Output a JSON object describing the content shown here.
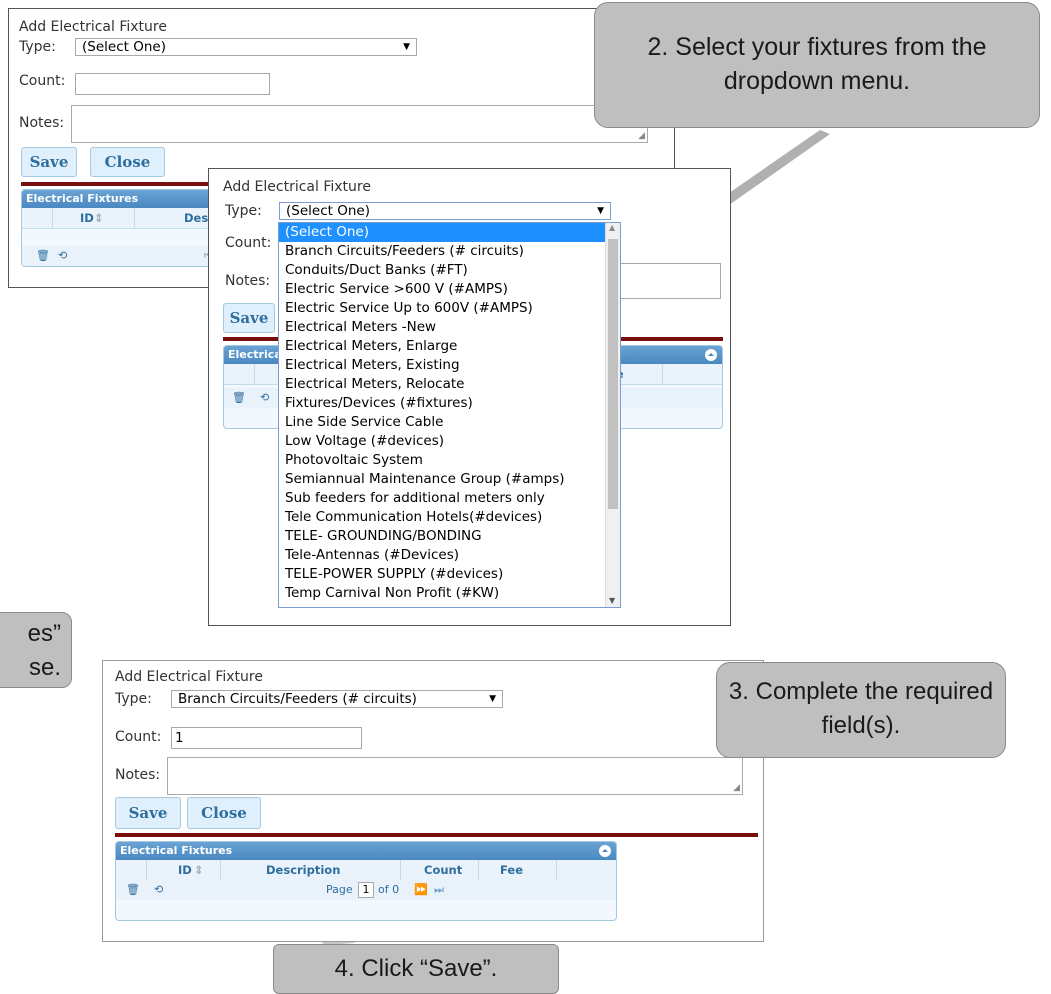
{
  "callouts": {
    "step2": "2. Select your fixtures from the dropdown menu.",
    "step3": "3. Complete the required field(s).",
    "step4": "4. Click “Save”.",
    "partial_left_line1": "es”",
    "partial_left_line2": "se."
  },
  "panel1": {
    "title": "Add Electrical Fixture",
    "type_label": "Type:",
    "type_value": "(Select One)",
    "count_label": "Count:",
    "count_value": "",
    "notes_label": "Notes:",
    "save": "Save",
    "close": "Close",
    "grid_title": "Electrical Fixtures",
    "col_id": "ID",
    "col_desc": "Descri"
  },
  "panel2": {
    "title": "Add Electrical Fixture",
    "type_label": "Type:",
    "type_value": "(Select One)",
    "count_label": "Count:",
    "notes_label": "Notes:",
    "save": "Save",
    "grid_title": "Electrica",
    "col_fee": "ee",
    "options": [
      "(Select One)",
      "Branch Circuits/Feeders (# circuits)",
      "Conduits/Duct Banks (#FT)",
      "Electric Service >600 V (#AMPS)",
      "Electric Service Up to 600V (#AMPS)",
      "Electrical Meters -New",
      "Electrical Meters, Enlarge",
      "Electrical Meters, Existing",
      "Electrical Meters, Relocate",
      "Fixtures/Devices (#fixtures)",
      "Line Side Service Cable",
      "Low Voltage (#devices)",
      "Photovoltaic System",
      "Semiannual Maintenance Group (#amps)",
      "Sub feeders for additional meters only",
      "Tele Communication Hotels(#devices)",
      "TELE- GROUNDING/BONDING",
      "Tele-Antennas (#Devices)",
      "TELE-POWER SUPPLY (#devices)",
      "Temp Carnival Non Profit (#KW)"
    ]
  },
  "panel3": {
    "title": "Add Electrical Fixture",
    "type_label": "Type:",
    "type_value": "Branch Circuits/Feeders (# circuits)",
    "count_label": "Count:",
    "count_value": "1",
    "notes_label": "Notes:",
    "save": "Save",
    "close": "Close",
    "grid_title": "Electrical Fixtures",
    "col_id": "ID",
    "col_desc": "Description",
    "col_count": "Count",
    "col_fee": "Fee",
    "pager_page": "Page",
    "pager_value": "1",
    "pager_of": "of 0"
  }
}
